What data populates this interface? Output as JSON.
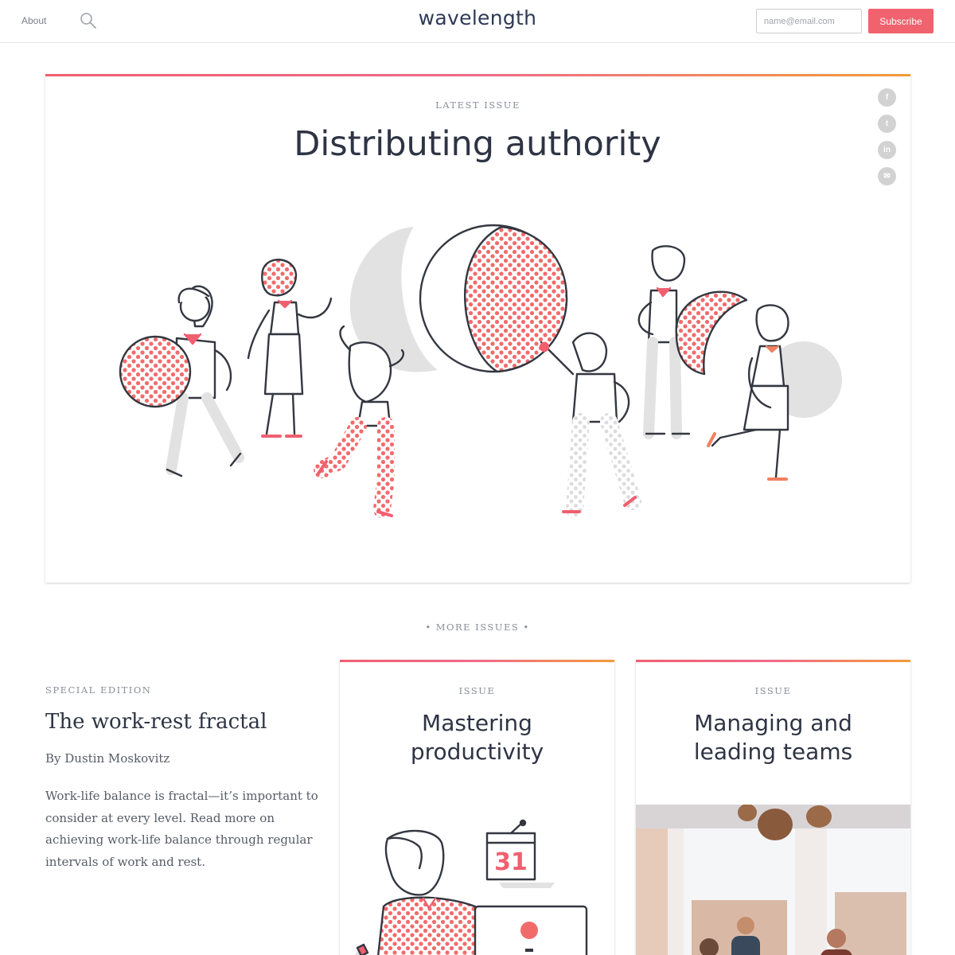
{
  "header": {
    "about_label": "About",
    "logo": "wavelength",
    "email_placeholder": "name@email.com",
    "subscribe_label": "Subscribe"
  },
  "feature": {
    "kicker": "LATEST ISSUE",
    "title": "Distributing authority",
    "share_icons": [
      "facebook-icon",
      "twitter-icon",
      "linkedin-icon",
      "email-icon"
    ],
    "share_glyphs": {
      "facebook": "f",
      "twitter": "t",
      "linkedin": "in",
      "email": "✉"
    }
  },
  "more_issues_label": "• MORE ISSUES •",
  "special_edition": {
    "kicker": "SPECIAL EDITION",
    "title": "The work-rest fractal",
    "author": "By Dustin Moskovitz",
    "description": "Work-life balance is fractal—it’s important to consider at every level. Read more on achieving work-life balance through regular intervals of work and rest."
  },
  "issues": [
    {
      "kicker": "ISSUE",
      "title_line1": "Mastering",
      "title_line2": "productivity",
      "calendar_day": "31"
    },
    {
      "kicker": "ISSUE",
      "title_line1": "Managing and",
      "title_line2": "leading teams"
    }
  ],
  "colors": {
    "accent": "#f0626e",
    "ink": "#2e3444",
    "dots": "#f26b6b",
    "gray_shape": "#e2e2e2"
  }
}
